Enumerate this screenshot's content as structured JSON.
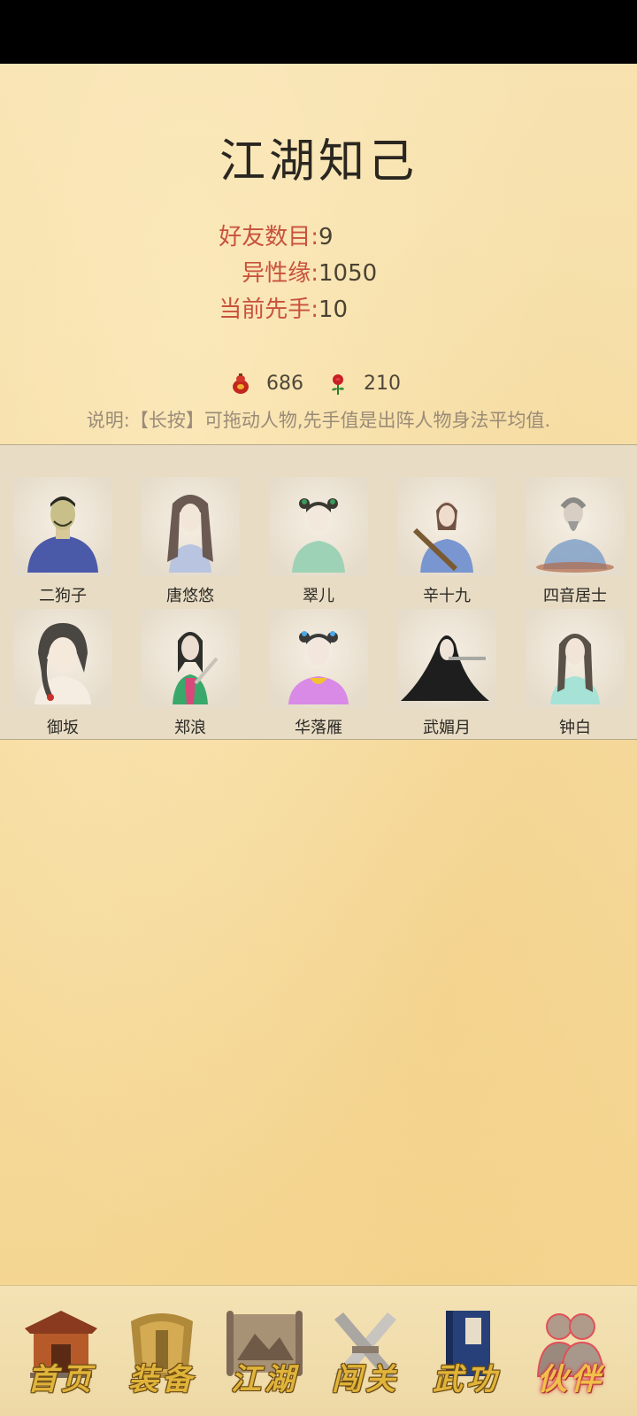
{
  "page": {
    "title": "江湖知己"
  },
  "stats": [
    {
      "label": "好友数目:",
      "value": "9"
    },
    {
      "label": "异性缘:",
      "value": "1050"
    },
    {
      "label": "当前先手:",
      "value": "10"
    }
  ],
  "currency": {
    "gourd_icon": "wine-gourd-icon",
    "gourd_count": "686",
    "rose_icon": "rose-icon",
    "rose_count": "210"
  },
  "note": "说明:【长按】可拖动人物,先手值是出阵人物身法平均值.",
  "companions": [
    {
      "name": "二狗子"
    },
    {
      "name": "唐悠悠"
    },
    {
      "name": "翠儿"
    },
    {
      "name": "辛十九"
    },
    {
      "name": "四音居士"
    },
    {
      "name": "御坂"
    },
    {
      "name": "郑浪"
    },
    {
      "name": "华落雁"
    },
    {
      "name": "武媚月"
    },
    {
      "name": "钟白"
    }
  ],
  "nav": [
    {
      "label": "首页",
      "icon": "temple-gate-icon"
    },
    {
      "label": "装备",
      "icon": "armor-icon"
    },
    {
      "label": "江湖",
      "icon": "scroll-map-icon"
    },
    {
      "label": "闯关",
      "icon": "crossed-swords-icon"
    },
    {
      "label": "武功",
      "icon": "book-icon"
    },
    {
      "label": "伙伴",
      "icon": "companions-icon",
      "active": true
    }
  ],
  "colors": {
    "label_red": "#c8523c",
    "value_text": "#4a4232",
    "note_text": "#9a8b78",
    "nav_gold": "#e0b33a"
  }
}
